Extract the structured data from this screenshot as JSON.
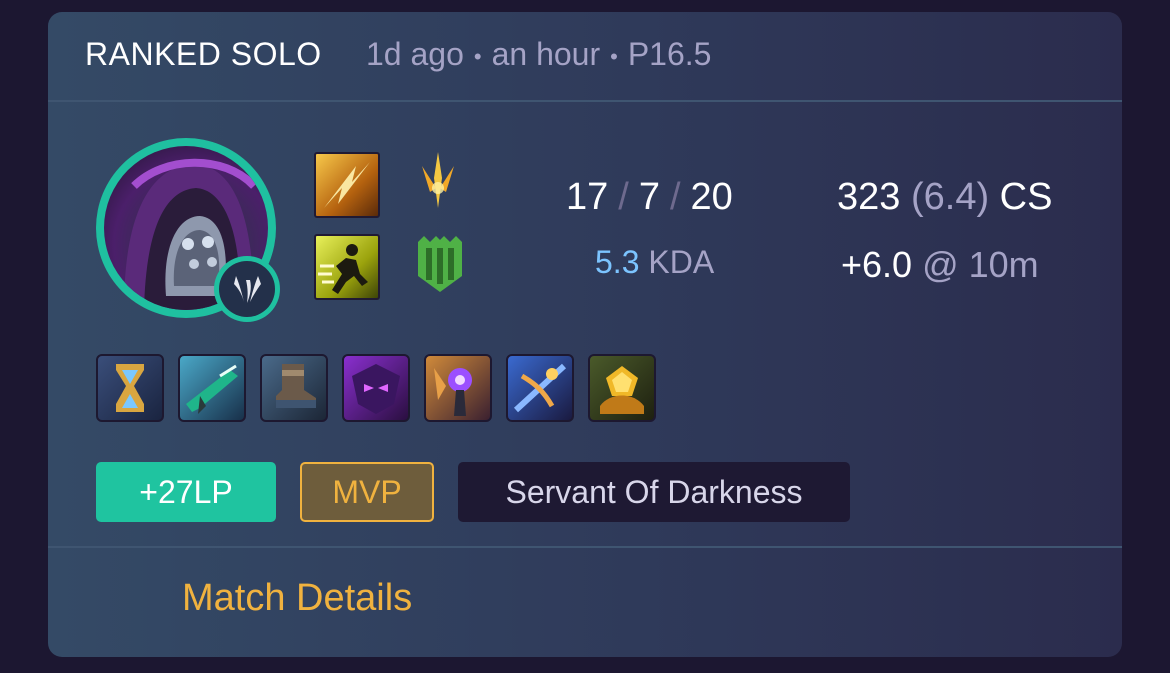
{
  "header": {
    "queue": "RANKED SOLO",
    "time_ago": "1d ago",
    "duration": "an hour",
    "patch": "P16.5",
    "separator": "•"
  },
  "champion": {
    "icon": "champion-portrait-hooded-helmet",
    "role_icon": "jungle-role-icon"
  },
  "spells": [
    {
      "icon": "summoner-spell-flash-icon"
    },
    {
      "icon": "summoner-spell-ghost-icon"
    }
  ],
  "runes": [
    {
      "icon": "rune-keystone-lethal-tempo-icon"
    },
    {
      "icon": "rune-secondary-resolve-icon"
    }
  ],
  "stats": {
    "kills": "17",
    "deaths": "7",
    "assists": "20",
    "slash": "/",
    "kda_value": "5.3",
    "kda_label": "KDA",
    "cs_total": "323",
    "cs_per_min": "(6.4)",
    "cs_label": "CS",
    "cs_diff": "+6.0",
    "cs_diff_at": "@ 10m"
  },
  "items": [
    {
      "icon": "item-hourglass-icon"
    },
    {
      "icon": "item-rifle-icon"
    },
    {
      "icon": "item-boots-icon"
    },
    {
      "icon": "item-shadow-mask-icon"
    },
    {
      "icon": "item-void-staff-icon"
    },
    {
      "icon": "item-crossbow-icon"
    },
    {
      "icon": "item-golden-trinket-icon"
    }
  ],
  "badges": {
    "lp": "+27LP",
    "mvp": "MVP",
    "title": "Servant Of Darkness"
  },
  "footer": {
    "details_label": "Match Details"
  },
  "colors": {
    "accent_teal": "#1fc4a0",
    "accent_gold": "#f0b23f",
    "kda_blue": "#7cc4ff"
  }
}
